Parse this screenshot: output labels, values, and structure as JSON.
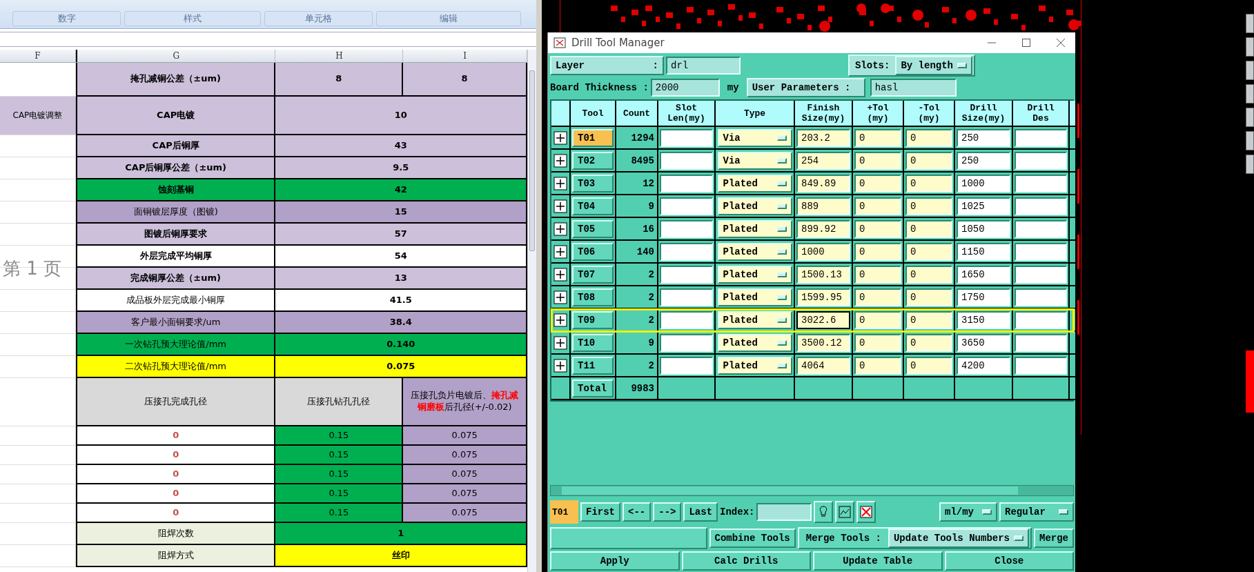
{
  "ribbon": {
    "groups": [
      "数字",
      "样式",
      "单元格",
      "编辑"
    ]
  },
  "sheet": {
    "columns": [
      "F",
      "G",
      "H",
      "I"
    ],
    "watermark": "第 1 页",
    "rows": [
      {
        "kind": "split",
        "label": "掩孔减铜公差（±um)",
        "bold": true,
        "values": [
          "8",
          "8"
        ],
        "color": "#ccc0da"
      },
      {
        "kind": "merged",
        "side": "CAP电镀调整",
        "label": "CAP电镀",
        "bold": true,
        "value": "10",
        "color": "#ccc0da"
      },
      {
        "kind": "merged",
        "label": "CAP后铜厚",
        "bold": true,
        "value": "43",
        "color": "#ccc0da"
      },
      {
        "kind": "merged",
        "label": "CAP后铜厚公差（±um)",
        "bold": true,
        "value": "9.5",
        "color": "#ccc0da"
      },
      {
        "kind": "merged",
        "label": "蚀刻基铜",
        "bold": true,
        "value": "42",
        "color": "#00b050"
      },
      {
        "kind": "merged",
        "label": "面铜镀层厚度（图镀)",
        "bold": false,
        "value": "15",
        "color": "#b1a0c7"
      },
      {
        "kind": "merged",
        "label": "图镀后铜厚要求",
        "bold": true,
        "value": "57",
        "color": "#ccc0da"
      },
      {
        "kind": "merged",
        "label": "外层完成平均铜厚",
        "bold": true,
        "value": "54",
        "color": "#ffffff"
      },
      {
        "kind": "merged",
        "label": "完成铜厚公差（±um)",
        "bold": true,
        "value": "13",
        "color": "#ccc0da"
      },
      {
        "kind": "merged",
        "label": "成品板外层完成最小铜厚",
        "bold": false,
        "value": "41.5",
        "color": "#ffffff"
      },
      {
        "kind": "merged",
        "label": "客户最小面铜要求/um",
        "bold": false,
        "value": "38.4",
        "color": "#b1a0c7"
      },
      {
        "kind": "merged",
        "label": "一次钻孔预大理论值/mm",
        "bold": false,
        "value": "0.140",
        "color": "#00b050"
      },
      {
        "kind": "merged",
        "label": "二次钻孔预大理论值/mm",
        "bold": false,
        "value": "0.075",
        "color": "#ffff00"
      },
      {
        "kind": "header",
        "cells": [
          "压接孔完成孔径",
          "压接孔钻孔孔径",
          "压接孔负片电镀后、**掩孔减铜磨板**后孔径(+/-0.02)"
        ]
      },
      {
        "kind": "data",
        "cells": [
          "0",
          "0.15",
          "0.075"
        ]
      },
      {
        "kind": "data",
        "cells": [
          "0",
          "0.15",
          "0.075"
        ]
      },
      {
        "kind": "data",
        "cells": [
          "0",
          "0.15",
          "0.075"
        ]
      },
      {
        "kind": "data",
        "cells": [
          "0",
          "0.15",
          "0.075"
        ]
      },
      {
        "kind": "data",
        "cells": [
          "0",
          "0.15",
          "0.075"
        ]
      },
      {
        "kind": "merged",
        "label": "阻焊次数",
        "bold": false,
        "value": "1",
        "color": "#00b050",
        "label_cell": {
          "color": "#ebf1de"
        }
      },
      {
        "kind": "merged",
        "label": "阻焊方式",
        "bold": false,
        "value": "丝印",
        "color": "#ffff00",
        "label_cell": {
          "color": "#ebf1de"
        }
      }
    ]
  },
  "drill_window": {
    "title": "Drill Tool Manager",
    "layer_label": "Layer",
    "layer_sep": ":",
    "layer_value": "drl",
    "slots_label": "Slots:",
    "slots_value": "By length",
    "thickness_label": "Board Thickness :",
    "thickness_value": "2000",
    "thickness_unit": "my",
    "user_params_label": "User Parameters :",
    "user_params_value": "hasl",
    "columns": [
      [
        "Tool"
      ],
      [
        "Count"
      ],
      [
        "Slot",
        "Len(my)"
      ],
      [
        "Type"
      ],
      [
        "Finish",
        "Size(my)"
      ],
      [
        "+Tol",
        "(my)"
      ],
      [
        "-Tol",
        "(my)"
      ],
      [
        "Drill",
        "Size(my)"
      ],
      [
        "Drill",
        "Des"
      ]
    ],
    "tools": [
      {
        "tool": "T01",
        "count": "1294",
        "type": "Via",
        "finish": "203.2",
        "plus_tol": "0",
        "minus_tol": "0",
        "drill": "250",
        "selected": true,
        "highlighted": false,
        "focused": false
      },
      {
        "tool": "T02",
        "count": "8495",
        "type": "Via",
        "finish": "254",
        "plus_tol": "0",
        "minus_tol": "0",
        "drill": "250",
        "selected": false,
        "highlighted": false,
        "focused": false
      },
      {
        "tool": "T03",
        "count": "12",
        "type": "Plated",
        "finish": "849.89",
        "plus_tol": "0",
        "minus_tol": "0",
        "drill": "1000",
        "selected": false,
        "highlighted": false,
        "focused": false
      },
      {
        "tool": "T04",
        "count": "9",
        "type": "Plated",
        "finish": "889",
        "plus_tol": "0",
        "minus_tol": "0",
        "drill": "1025",
        "selected": false,
        "highlighted": false,
        "focused": false
      },
      {
        "tool": "T05",
        "count": "16",
        "type": "Plated",
        "finish": "899.92",
        "plus_tol": "0",
        "minus_tol": "0",
        "drill": "1050",
        "selected": false,
        "highlighted": false,
        "focused": false
      },
      {
        "tool": "T06",
        "count": "140",
        "type": "Plated",
        "finish": "1000",
        "plus_tol": "0",
        "minus_tol": "0",
        "drill": "1150",
        "selected": false,
        "highlighted": false,
        "focused": false
      },
      {
        "tool": "T07",
        "count": "2",
        "type": "Plated",
        "finish": "1500.13",
        "plus_tol": "0",
        "minus_tol": "0",
        "drill": "1650",
        "selected": false,
        "highlighted": false,
        "focused": false
      },
      {
        "tool": "T08",
        "count": "2",
        "type": "Plated",
        "finish": "1599.95",
        "plus_tol": "0",
        "minus_tol": "0",
        "drill": "1750",
        "selected": false,
        "highlighted": false,
        "focused": false
      },
      {
        "tool": "T09",
        "count": "2",
        "type": "Plated",
        "finish": "3022.6",
        "plus_tol": "0",
        "minus_tol": "0",
        "drill": "3150",
        "selected": false,
        "highlighted": true,
        "focused": true
      },
      {
        "tool": "T10",
        "count": "9",
        "type": "Plated",
        "finish": "3500.12",
        "plus_tol": "0",
        "minus_tol": "0",
        "drill": "3650",
        "selected": false,
        "highlighted": false,
        "focused": false
      },
      {
        "tool": "T11",
        "count": "2",
        "type": "Plated",
        "finish": "4064",
        "plus_tol": "0",
        "minus_tol": "0",
        "drill": "4200",
        "selected": false,
        "highlighted": false,
        "focused": false
      }
    ],
    "total_label": "Total",
    "total_count": "9983",
    "current_tool": "T01",
    "nav": [
      "First",
      "<--",
      "-->",
      "Last"
    ],
    "index_label": "Index:",
    "units": "ml/my",
    "mode": "Regular",
    "combine": "Combine Tools",
    "merge_label": "Merge Tools :",
    "merge_mode": "Update Tools Numbers",
    "merge": "Merge",
    "actions": [
      "Apply",
      "Calc Drills",
      "Update Table",
      "Close"
    ]
  }
}
